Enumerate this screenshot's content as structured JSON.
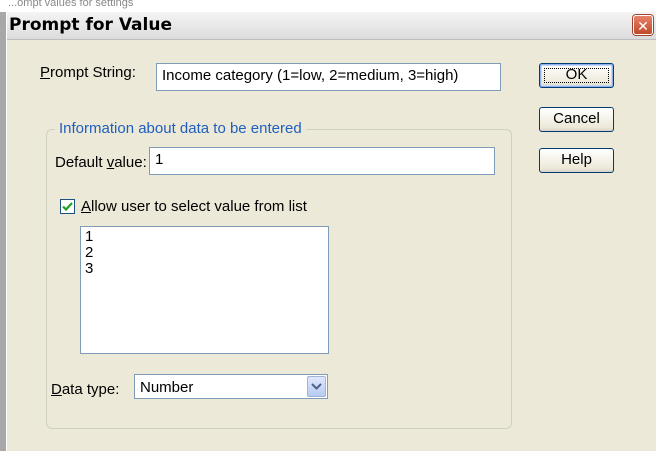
{
  "window": {
    "title": "Prompt for Value",
    "top_strip_text": "...ompt values for settings"
  },
  "prompt": {
    "label_underline": "P",
    "label_rest": "rompt String:",
    "value": "Income category (1=low, 2=medium, 3=high)"
  },
  "group": {
    "title": "Information about data to be entered",
    "default_label_before": "Default ",
    "default_label_underline": "v",
    "default_label_after": "alue:",
    "default_value": "1",
    "allow_checked": true,
    "allow_label_underline": "A",
    "allow_label_rest": "llow user to select value from list",
    "list_items": [
      "1",
      "2",
      "3"
    ],
    "datatype_label_underline": "D",
    "datatype_label_rest": "ata type:",
    "datatype_value": "Number"
  },
  "buttons": {
    "ok": "OK",
    "cancel": "Cancel",
    "help": "Help"
  },
  "colors": {
    "group_title": "#1f5fbf",
    "close_button": "#c04a2a",
    "check_mark": "#21a121"
  }
}
